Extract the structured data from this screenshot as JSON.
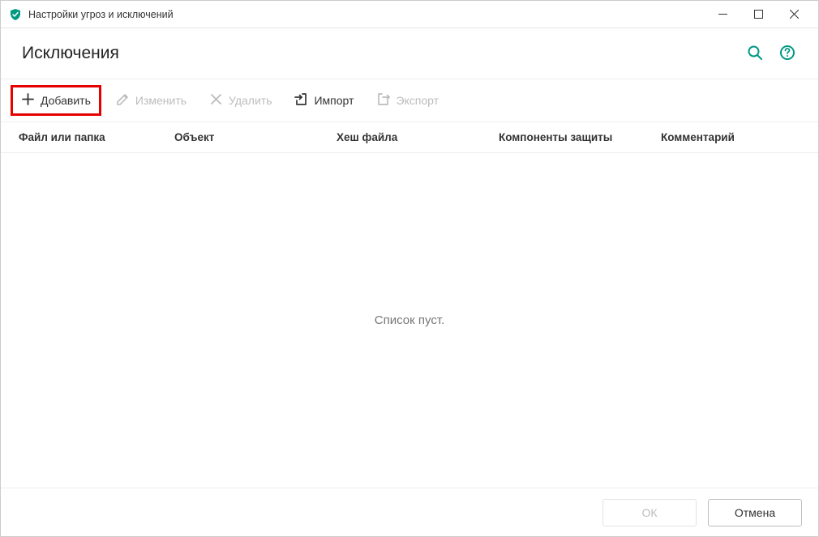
{
  "window": {
    "title": "Настройки угроз и исключений"
  },
  "header": {
    "title": "Исключения"
  },
  "toolbar": {
    "add_label": "Добавить",
    "edit_label": "Изменить",
    "delete_label": "Удалить",
    "import_label": "Импорт",
    "export_label": "Экспорт"
  },
  "columns": {
    "file_or_folder": "Файл или папка",
    "object": "Объект",
    "file_hash": "Хеш файла",
    "components": "Компоненты защиты",
    "comment": "Комментарий"
  },
  "empty_text": "Список пуст.",
  "footer": {
    "ok_label": "ОК",
    "cancel_label": "Отмена"
  },
  "colors": {
    "accent": "#009982",
    "highlight": "#e60000",
    "disabled": "#bcbcbc"
  }
}
